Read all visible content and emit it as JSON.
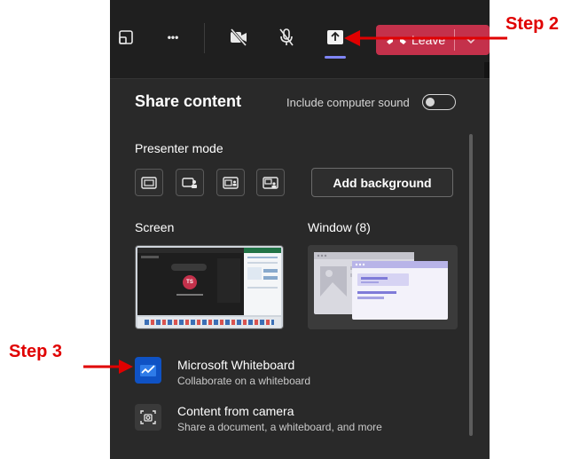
{
  "toolbar": {
    "icons": [
      "view-icon",
      "more-icon",
      "camera-off-icon",
      "mic-off-icon",
      "share-icon"
    ],
    "more_label": "•••",
    "leave_label": "Leave"
  },
  "share_panel": {
    "title": "Share content",
    "include_sound_label": "Include computer sound",
    "presenter_mode_label": "Presenter mode",
    "add_background_label": "Add background",
    "screen_label": "Screen",
    "window_label": "Window (8)",
    "screen_thumb_initials": "TS",
    "options": [
      {
        "title": "Microsoft Whiteboard",
        "subtitle": "Collaborate on a whiteboard"
      },
      {
        "title": "Content from camera",
        "subtitle": "Share a document, a whiteboard, and more"
      }
    ]
  },
  "annotations": {
    "step2": "Step 2",
    "step3": "Step 3"
  },
  "colors": {
    "leave": "#c4314b",
    "accent": "#7f85f5",
    "annotation": "#e00000",
    "whiteboard": "#0f52c4"
  }
}
